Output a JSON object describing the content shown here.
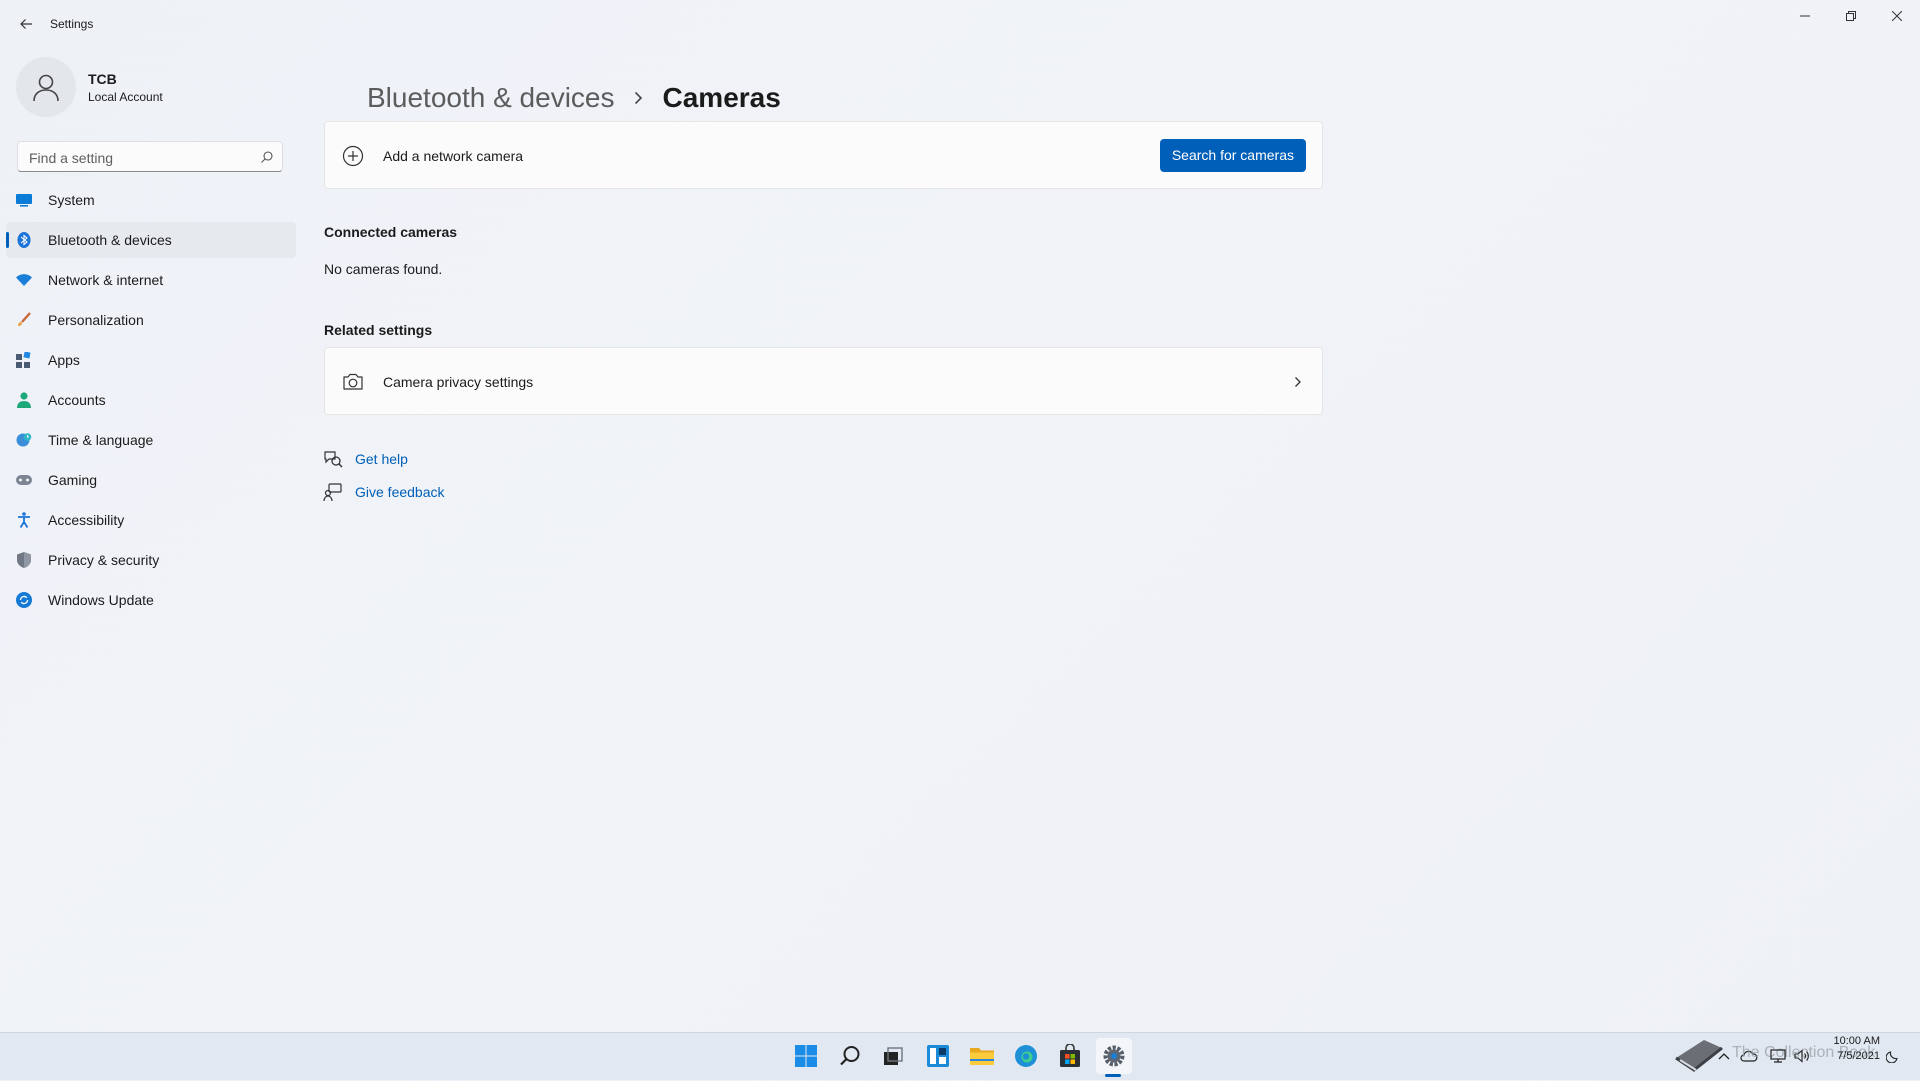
{
  "window": {
    "app_title": "Settings"
  },
  "profile": {
    "name": "TCB",
    "account_type": "Local Account"
  },
  "search": {
    "placeholder": "Find a setting",
    "value": ""
  },
  "nav": {
    "items": [
      {
        "label": "System",
        "icon": "monitor-icon",
        "active": false
      },
      {
        "label": "Bluetooth & devices",
        "icon": "bluetooth-icon",
        "active": true
      },
      {
        "label": "Network & internet",
        "icon": "wifi-icon",
        "active": false
      },
      {
        "label": "Personalization",
        "icon": "brush-icon",
        "active": false
      },
      {
        "label": "Apps",
        "icon": "apps-icon",
        "active": false
      },
      {
        "label": "Accounts",
        "icon": "person-icon",
        "active": false
      },
      {
        "label": "Time & language",
        "icon": "globe-clock-icon",
        "active": false
      },
      {
        "label": "Gaming",
        "icon": "gamepad-icon",
        "active": false
      },
      {
        "label": "Accessibility",
        "icon": "accessibility-icon",
        "active": false
      },
      {
        "label": "Privacy & security",
        "icon": "shield-icon",
        "active": false
      },
      {
        "label": "Windows Update",
        "icon": "update-icon",
        "active": false
      }
    ]
  },
  "breadcrumb": {
    "parent": "Bluetooth & devices",
    "current": "Cameras"
  },
  "add_camera": {
    "label": "Add a network camera",
    "button": "Search for cameras"
  },
  "connected": {
    "title": "Connected cameras",
    "empty_text": "No cameras found."
  },
  "related": {
    "title": "Related settings",
    "items": [
      {
        "label": "Camera privacy settings"
      }
    ]
  },
  "help": {
    "get_help": "Get help",
    "give_feedback": "Give feedback"
  },
  "taskbar": {
    "apps": [
      "start-icon",
      "search-icon",
      "task-view-icon",
      "widgets-icon",
      "file-explorer-icon",
      "edge-icon",
      "store-icon",
      "settings-icon"
    ],
    "active_app": "settings-icon"
  },
  "tray": {
    "time": "10:00 AM",
    "date": "7/5/2021",
    "watermark": "The Collection Book"
  },
  "colors": {
    "accent": "#005fb8",
    "background": "#eef2f7",
    "card": "#fbfbfc"
  }
}
